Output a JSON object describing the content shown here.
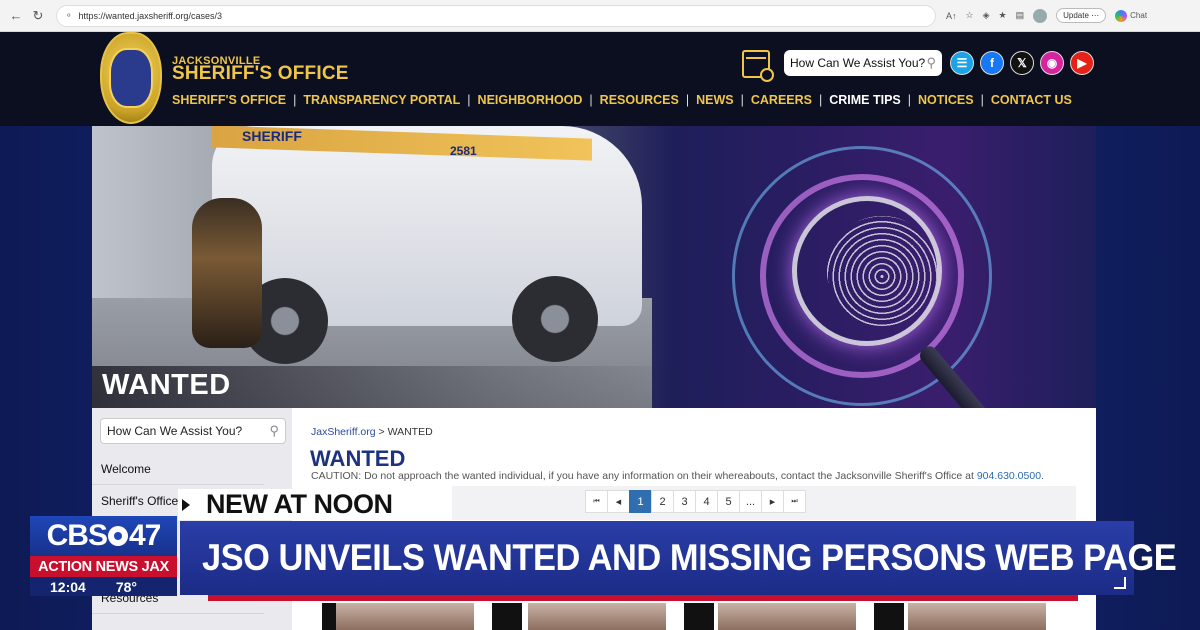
{
  "browser": {
    "url": "https://wanted.jaxsheriff.org/cases/3",
    "update_label": "Update",
    "chat_label": "Chat"
  },
  "header": {
    "brand_small": "JACKSONVILLE",
    "brand_big": "SHERIFF'S OFFICE",
    "search_placeholder": "How Can We Assist You?",
    "nav": [
      {
        "label": "SHERIFF'S OFFICE"
      },
      {
        "label": "TRANSPARENCY PORTAL"
      },
      {
        "label": "NEIGHBORHOOD"
      },
      {
        "label": "RESOURCES"
      },
      {
        "label": "NEWS"
      },
      {
        "label": "CAREERS"
      },
      {
        "label": "CRIME TIPS"
      },
      {
        "label": "NOTICES"
      },
      {
        "label": "CONTACT US"
      }
    ],
    "social": [
      {
        "icon": "translate-icon",
        "color": "#1aa3e8"
      },
      {
        "icon": "facebook-icon",
        "color": "#1877f2"
      },
      {
        "icon": "x-icon",
        "color": "#111111"
      },
      {
        "icon": "instagram-icon",
        "color": "#d6249f"
      },
      {
        "icon": "youtube-icon",
        "color": "#e62117"
      }
    ]
  },
  "hero": {
    "title": "WANTED",
    "car_text": "SHERIFF",
    "car_number": "2581"
  },
  "sidebar": {
    "search_placeholder": "How Can We Assist You?",
    "items": [
      {
        "label": "Welcome"
      },
      {
        "label": "Sheriff's Office"
      },
      {
        "label": "Resources"
      }
    ]
  },
  "main": {
    "breadcrumb_link": "JaxSheriff.org",
    "breadcrumb_sep": ">",
    "breadcrumb_current": "WANTED",
    "title": "WANTED",
    "caution_text": "CAUTION: Do not approach the wanted individual, if you have any information on their whereabouts, contact the Jacksonville Sheriff's Office at",
    "caution_phone": "904.630.0500",
    "caution_end": ".",
    "pager": [
      "⏮",
      "◀",
      "1",
      "2",
      "3",
      "4",
      "5",
      "...",
      "▶",
      "⏭"
    ],
    "pager_active": "1"
  },
  "overlay": {
    "cbs_left": "CBS",
    "cbs_right": "47",
    "action": "ACTION NEWS JAX",
    "time": "12:04",
    "temp": "78°",
    "kicker": "NEW AT NOON",
    "headline": "JSO UNVEILS WANTED AND MISSING PERSONS WEB PAGE",
    "colors": {
      "cbs_blue": "#1f46b8",
      "action_red": "#c8102e",
      "headline_blue": "#2a3ea8"
    }
  }
}
